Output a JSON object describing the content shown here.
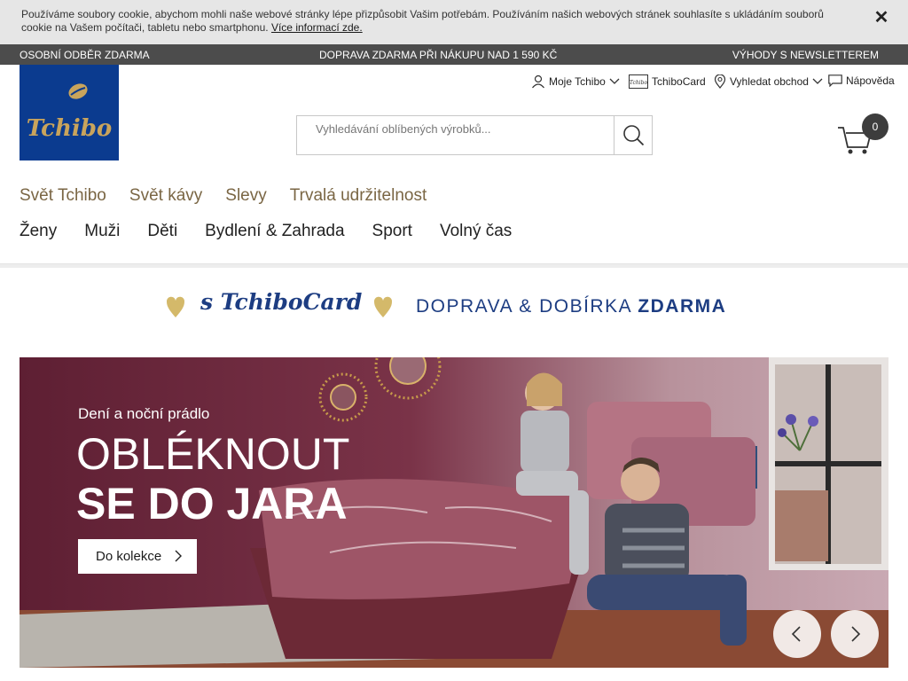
{
  "cookie": {
    "text": "Používáme soubory cookie, abychom mohli naše webové stránky lépe přizpůsobit Vašim potřebám. Používáním našich webových stránek souhlasíte s ukládáním souborů cookie na Vašem počítači, tabletu nebo smartphonu.",
    "link": "Více informací zde.",
    "close": "✕"
  },
  "info_strip": {
    "left": "OSOBNÍ ODBĚR ZDARMA",
    "center": "DOPRAVA ZDARMA PŘI NÁKUPU NAD 1 590 KČ",
    "right": "VÝHODY S NEWSLETTEREM"
  },
  "header": {
    "logo_text": "Tchibo",
    "services": {
      "moje": "Moje Tchibo",
      "card": "TchiboCard",
      "shop": "Vyhledat obchod",
      "help": "Nápověda"
    },
    "search_placeholder": "Vyhledávání oblíbených výrobků...",
    "cart_count": "0"
  },
  "nav": {
    "primary": [
      "Svět Tchibo",
      "Svět kávy",
      "Slevy",
      "Trvalá udržitelnost"
    ],
    "secondary": [
      "Ženy",
      "Muži",
      "Děti",
      "Bydlení & Zahrada",
      "Sport",
      "Volný čas"
    ]
  },
  "promo": {
    "card": "s TchiboCard",
    "text_regular": "DOPRAVA & DOBÍRKA ",
    "text_bold": "ZDARMA"
  },
  "hero": {
    "kicker": "Dení a noční prádlo",
    "title_line1": "OBLÉKNOUT",
    "title_line2": "SE DO JARA",
    "cta": "Do kolekce"
  },
  "colors": {
    "brand_blue": "#0b3b8f",
    "nav_gold": "#7a6644",
    "promo_navy": "#1d3d82",
    "heart_gold": "#d4b96a"
  }
}
